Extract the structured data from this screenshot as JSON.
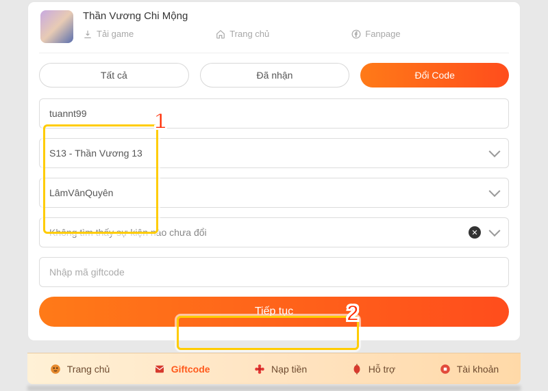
{
  "game": {
    "title": "Thần Vương Chi Mộng",
    "links": {
      "download": "Tải game",
      "home": "Trang chủ",
      "fanpage": "Fanpage"
    }
  },
  "tabs": {
    "all": "Tất cả",
    "received": "Đã nhận",
    "redeem": "Đổi Code"
  },
  "form": {
    "username": "tuannt99",
    "server": "S13 - Thần Vương 13",
    "character": "LâmVânQuyên",
    "event_empty": "Không tìm thấy sự kiện nào chưa đổi",
    "giftcode_placeholder": "Nhập mã giftcode",
    "submit": "Tiếp tục"
  },
  "callouts": {
    "one": "1",
    "two": "2"
  },
  "nav": {
    "home": "Trang chủ",
    "giftcode": "Giftcode",
    "topup": "Nạp tiền",
    "support": "Hỗ trợ",
    "account": "Tài khoản"
  },
  "colors": {
    "accent": "#ff5a1c",
    "highlight": "#ffcc00"
  }
}
